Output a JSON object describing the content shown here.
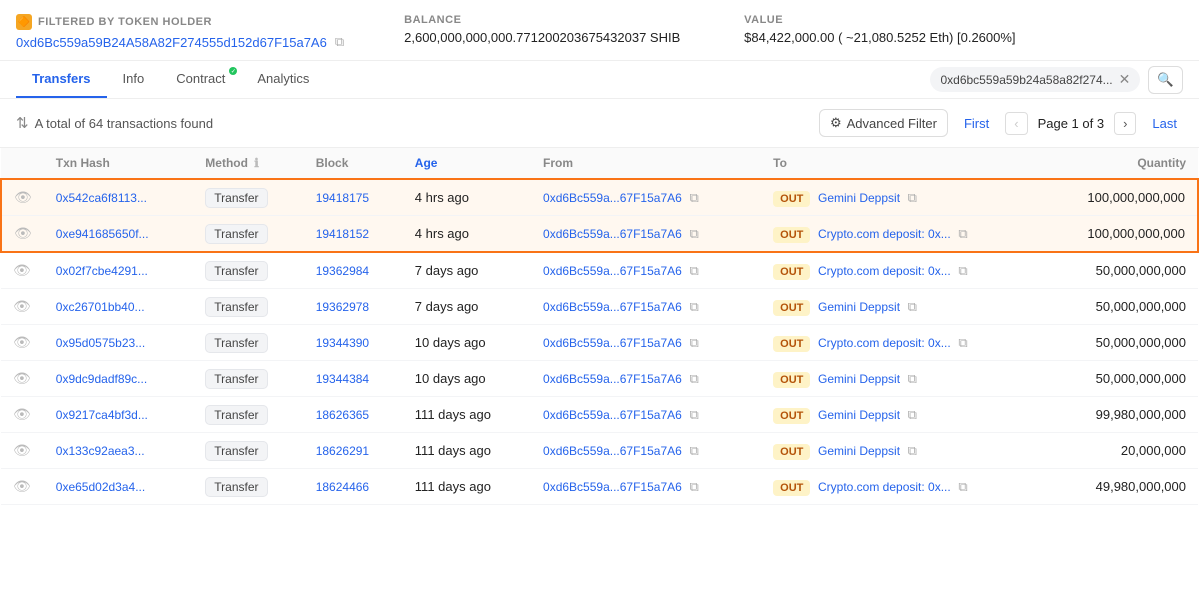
{
  "header": {
    "filtered_label": "FILTERED BY TOKEN HOLDER",
    "address": "0xd6Bc559a59B24A58A82F274555d152d67F15a7A6",
    "address_short": "0xd6Bc559a59B24A58A82F274555d152d67F15a7A6",
    "balance_label": "BALANCE",
    "balance_value": "2,600,000,000,000.771200203675432037 SHIB",
    "value_label": "VALUE",
    "value_value": "$84,422,000.00 ( ~21,080.5252 Eth) [0.2600%]"
  },
  "nav": {
    "tabs": [
      {
        "id": "transfers",
        "label": "Transfers",
        "active": true,
        "badge": false
      },
      {
        "id": "info",
        "label": "Info",
        "active": false,
        "badge": false
      },
      {
        "id": "contract",
        "label": "Contract",
        "active": false,
        "badge": true
      },
      {
        "id": "analytics",
        "label": "Analytics",
        "active": false,
        "badge": false
      }
    ],
    "chip_address": "0xd6bc559a59b24a58a82f274...",
    "search_icon": "🔍"
  },
  "toolbar": {
    "sort_icon": "⇅",
    "total_text": "A total of 64 transactions found",
    "advanced_filter_label": "Advanced Filter",
    "first_label": "First",
    "last_label": "Last",
    "page_text": "Page 1 of 3"
  },
  "table": {
    "columns": [
      {
        "id": "eye",
        "label": ""
      },
      {
        "id": "txn_hash",
        "label": "Txn Hash"
      },
      {
        "id": "method",
        "label": "Method"
      },
      {
        "id": "block",
        "label": "Block"
      },
      {
        "id": "age",
        "label": "Age"
      },
      {
        "id": "from",
        "label": "From"
      },
      {
        "id": "to",
        "label": "To"
      },
      {
        "id": "quantity",
        "label": "Quantity"
      }
    ],
    "rows": [
      {
        "eye": "👁",
        "txn_hash": "0x542ca6f8113...",
        "method": "Transfer",
        "block": "19418175",
        "age": "4 hrs ago",
        "from": "0xd6Bc559a...67F15a7A6",
        "direction": "OUT",
        "to": "Gemini Deppsit",
        "quantity": "100,000,000,000",
        "highlight": true
      },
      {
        "eye": "👁",
        "txn_hash": "0xe941685650f...",
        "method": "Transfer",
        "block": "19418152",
        "age": "4 hrs ago",
        "from": "0xd6Bc559a...67F15a7A6",
        "direction": "OUT",
        "to": "Crypto.com deposit: 0x...",
        "quantity": "100,000,000,000",
        "highlight": true
      },
      {
        "eye": "👁",
        "txn_hash": "0x02f7cbe4291...",
        "method": "Transfer",
        "block": "19362984",
        "age": "7 days ago",
        "from": "0xd6Bc559a...67F15a7A6",
        "direction": "OUT",
        "to": "Crypto.com deposit: 0x...",
        "quantity": "50,000,000,000",
        "highlight": false
      },
      {
        "eye": "👁",
        "txn_hash": "0xc26701bb40...",
        "method": "Transfer",
        "block": "19362978",
        "age": "7 days ago",
        "from": "0xd6Bc559a...67F15a7A6",
        "direction": "OUT",
        "to": "Gemini Deppsit",
        "quantity": "50,000,000,000",
        "highlight": false
      },
      {
        "eye": "👁",
        "txn_hash": "0x95d0575b23...",
        "method": "Transfer",
        "block": "19344390",
        "age": "10 days ago",
        "from": "0xd6Bc559a...67F15a7A6",
        "direction": "OUT",
        "to": "Crypto.com deposit: 0x...",
        "quantity": "50,000,000,000",
        "highlight": false
      },
      {
        "eye": "👁",
        "txn_hash": "0x9dc9dadf89c...",
        "method": "Transfer",
        "block": "19344384",
        "age": "10 days ago",
        "from": "0xd6Bc559a...67F15a7A6",
        "direction": "OUT",
        "to": "Gemini Deppsit",
        "quantity": "50,000,000,000",
        "highlight": false
      },
      {
        "eye": "👁",
        "txn_hash": "0x9217ca4bf3d...",
        "method": "Transfer",
        "block": "18626365",
        "age": "111 days ago",
        "from": "0xd6Bc559a...67F15a7A6",
        "direction": "OUT",
        "to": "Gemini Deppsit",
        "quantity": "99,980,000,000",
        "highlight": false
      },
      {
        "eye": "👁",
        "txn_hash": "0x133c92aea3...",
        "method": "Transfer",
        "block": "18626291",
        "age": "111 days ago",
        "from": "0xd6Bc559a...67F15a7A6",
        "direction": "OUT",
        "to": "Gemini Deppsit",
        "quantity": "20,000,000",
        "highlight": false
      },
      {
        "eye": "👁",
        "txn_hash": "0xe65d02d3a4...",
        "method": "Transfer",
        "block": "18624466",
        "age": "111 days ago",
        "from": "0xd6Bc559a...67F15a7A6",
        "direction": "OUT",
        "to": "Crypto.com deposit: 0x...",
        "quantity": "49,980,000,000",
        "highlight": false
      }
    ]
  },
  "icons": {
    "filter": "🔶",
    "copy": "⧉",
    "eye": "👁",
    "sort": "⇅",
    "funnel": "⚙",
    "chevron_left": "‹",
    "chevron_right": "›",
    "close": "✕",
    "search": "🔍",
    "info": "ℹ"
  }
}
